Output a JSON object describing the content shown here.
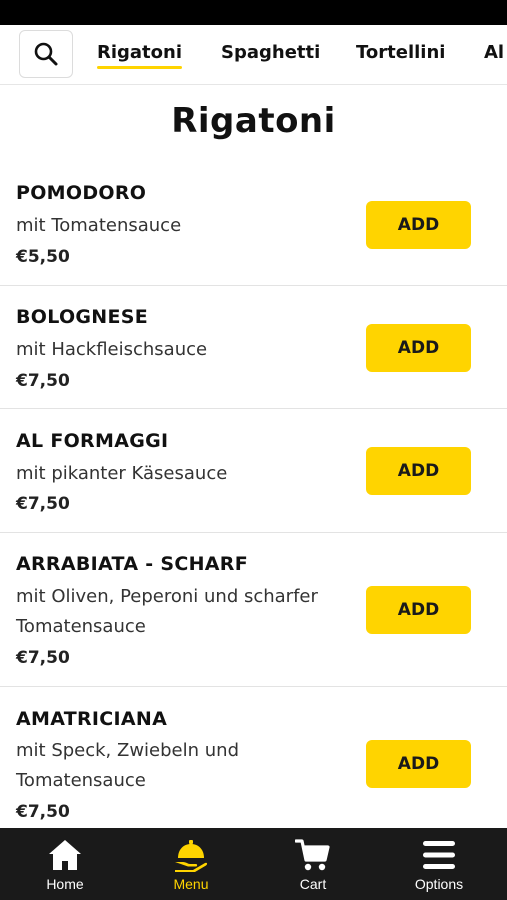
{
  "header": {
    "tabs": [
      {
        "label": "Rigatoni",
        "active": true
      },
      {
        "label": "Spaghetti",
        "active": false
      },
      {
        "label": "Tortellini",
        "active": false
      },
      {
        "label": "Al",
        "active": false
      }
    ],
    "search_icon": "search-icon"
  },
  "section": {
    "title": "Rigatoni"
  },
  "items": [
    {
      "name": "POMODORO",
      "desc": "mit Tomatensauce",
      "price": "€5,50",
      "add_label": "ADD"
    },
    {
      "name": "BOLOGNESE",
      "desc": "mit Hackfleischsauce",
      "price": "€7,50",
      "add_label": "ADD"
    },
    {
      "name": "AL FORMAGGI",
      "desc": "mit pikanter Käsesauce",
      "price": "€7,50",
      "add_label": "ADD"
    },
    {
      "name": "ARRABIATA - SCHARF",
      "desc": "mit Oliven, Peperoni und scharfer Tomatensauce",
      "price": "€7,50",
      "add_label": "ADD"
    },
    {
      "name": "AMATRICIANA",
      "desc": "mit Speck, Zwiebeln und Tomatensauce",
      "price": "€7,50",
      "add_label": "ADD"
    }
  ],
  "bottom_nav": [
    {
      "label": "Home",
      "icon": "home-icon",
      "active": false
    },
    {
      "label": "Menu",
      "icon": "serving-cloche-icon",
      "active": true
    },
    {
      "label": "Cart",
      "icon": "cart-icon",
      "active": false
    },
    {
      "label": "Options",
      "icon": "hamburger-menu-icon",
      "active": false
    }
  ],
  "colors": {
    "accent": "#ffd400",
    "nav_background": "#1a1a1a",
    "status_bar": "#000000"
  }
}
